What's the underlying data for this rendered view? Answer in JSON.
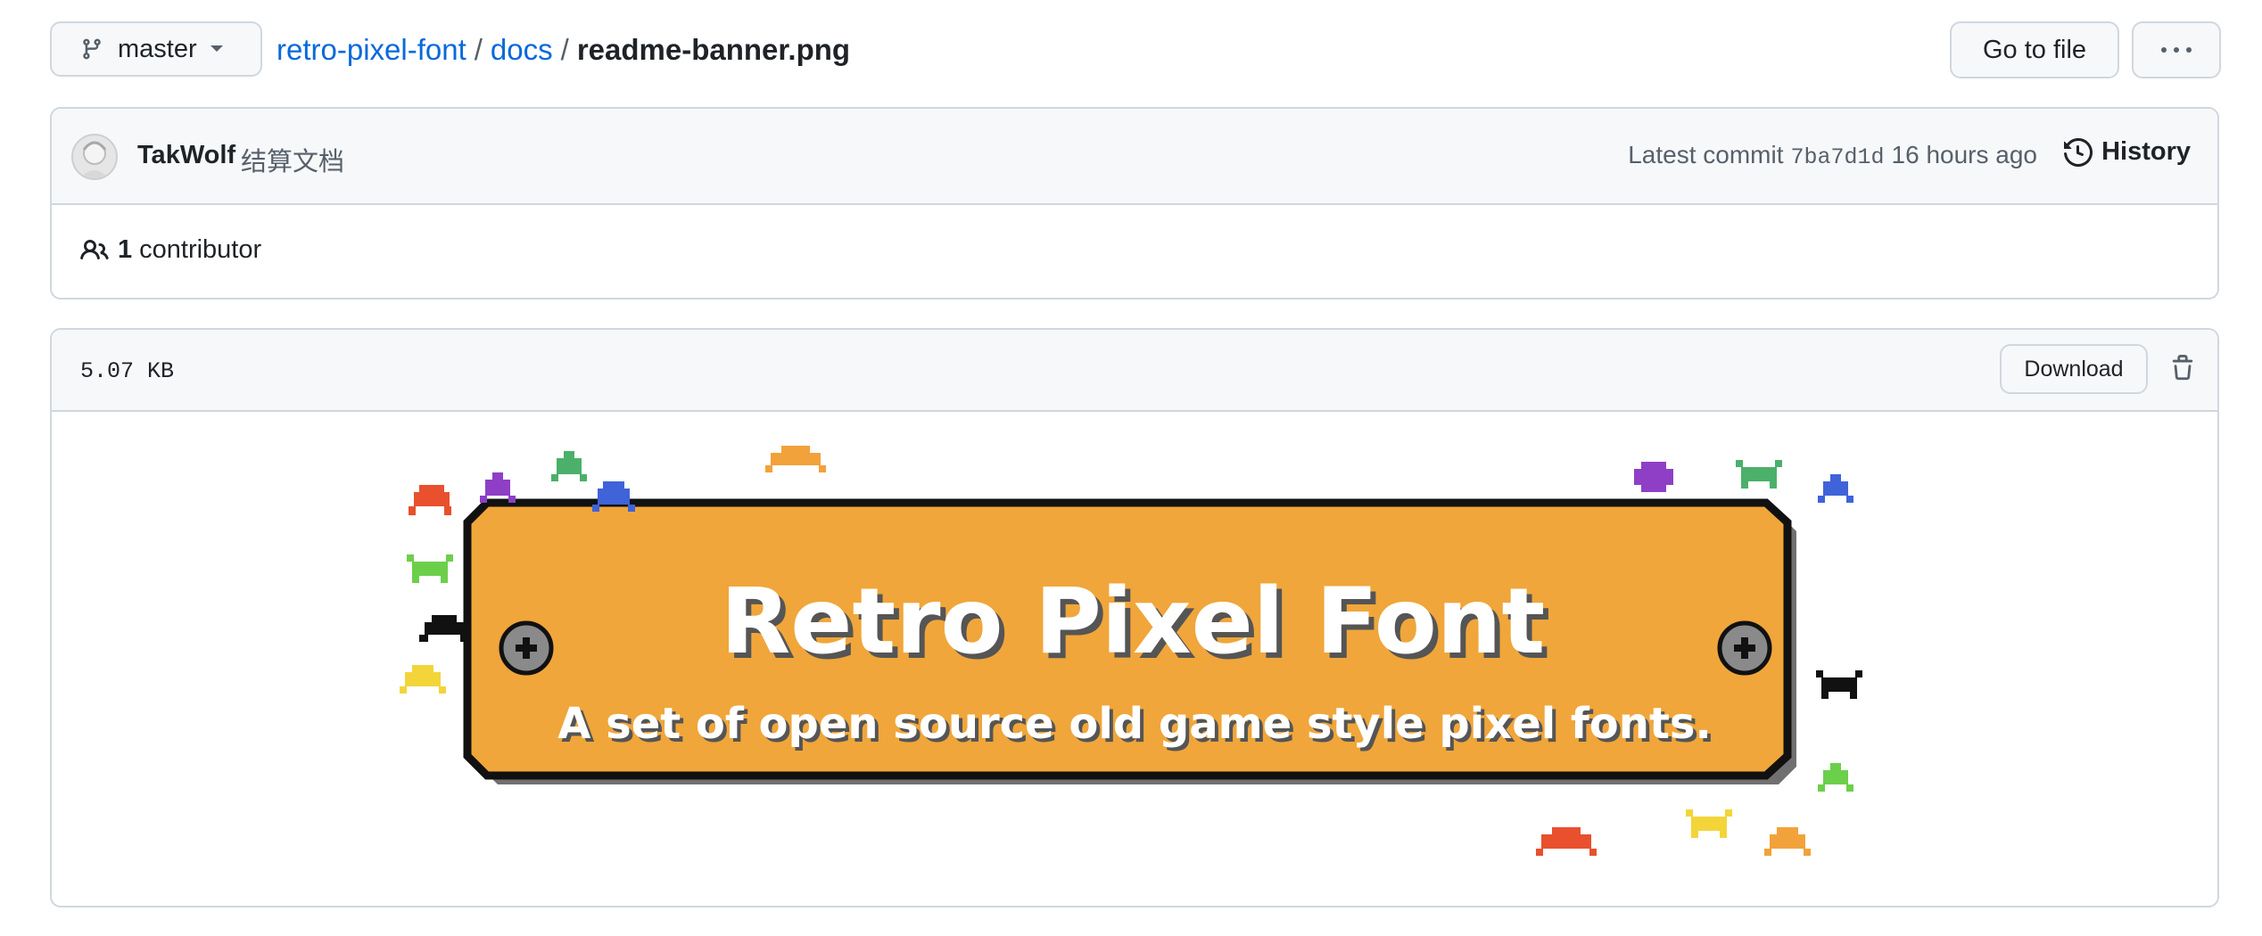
{
  "branch": {
    "label": "master"
  },
  "breadcrumb": {
    "repo": "retro-pixel-font",
    "sep": "/",
    "folder": "docs",
    "file": "readme-banner.png"
  },
  "header_buttons": {
    "goto_file": "Go to file",
    "more": "···"
  },
  "commit": {
    "author": "TakWolf",
    "message": "结算文档",
    "latest_label": "Latest commit",
    "sha": "7ba7d1d",
    "time": "16 hours ago",
    "history_label": "History"
  },
  "contributors": {
    "count": "1",
    "label": "contributor"
  },
  "file": {
    "size": "5.07 KB",
    "download_label": "Download"
  },
  "banner": {
    "title": "Retro Pixel Font",
    "subtitle": "A set of open source old game style pixel fonts.",
    "plate_color": "#f0a63a"
  },
  "colors": {
    "link": "#0969da",
    "border": "#d0d7de",
    "header_bg": "#f6f8fa",
    "muted": "#57606a"
  },
  "icons": [
    "branch-icon",
    "caret-down-icon",
    "kebab-icon",
    "history-icon",
    "people-icon",
    "trash-icon",
    "screw-icon",
    "space-invader-icon"
  ]
}
